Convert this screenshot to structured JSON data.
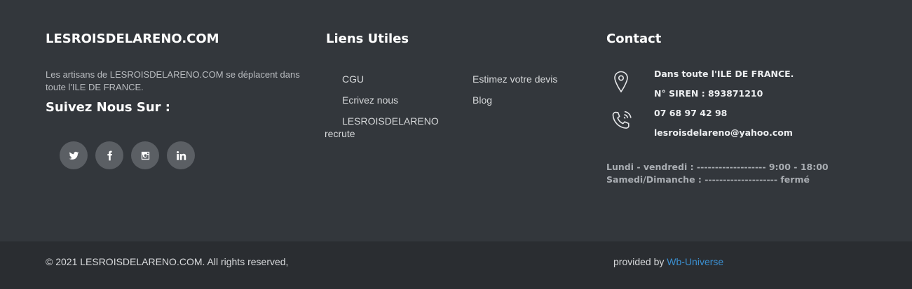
{
  "about": {
    "title": "LESROISDELARENO.COM",
    "description": "Les artisans de LESROISDELARENO.COM se déplacent dans toute l'ILE DE FRANCE.",
    "follow_title": "Suivez Nous Sur :",
    "socials": [
      {
        "name": "twitter",
        "icon": "twitter-icon"
      },
      {
        "name": "facebook",
        "icon": "facebook-icon"
      },
      {
        "name": "instagram",
        "icon": "instagram-icon"
      },
      {
        "name": "linkedin",
        "icon": "linkedin-icon"
      }
    ]
  },
  "links": {
    "title": "Liens Utiles",
    "items": [
      "CGU",
      "Ecrivez nous",
      "LESROISDELARENO recrute",
      "Estimez votre devis",
      "Blog"
    ]
  },
  "contact": {
    "title": "Contact",
    "location_icon": "map-pin-icon",
    "phone_icon": "phone-icon",
    "area": "Dans toute l'ILE DE FRANCE.",
    "siren": "N° SIREN : 893871210",
    "phone": "07 68 97 42 98",
    "email": "lesroisdelareno@yahoo.com",
    "hours": [
      "Lundi - vendredi : ------------------- 9:00 - 18:00",
      "Samedi/Dimanche : -------------------- fermé"
    ]
  },
  "bottom": {
    "copyright": "© 2021 LESROISDELARENO.COM. All rights reserved,",
    "provided_by": "provided by ",
    "provider_link": "Wb-Universe"
  },
  "colors": {
    "background": "#33373c",
    "bottom_bar": "#2a2d31",
    "social_bg": "#5b5f64",
    "link_accent": "#3b8fd0"
  }
}
